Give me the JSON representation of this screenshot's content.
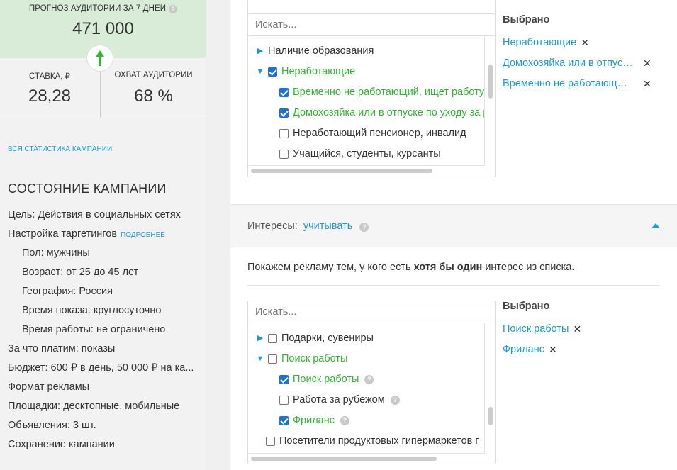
{
  "sidebar": {
    "forecast_label": "ПРОГНОЗ АУДИТОРИИ ЗА 7 ДНЕЙ",
    "forecast_value": "471 000",
    "rate_label": "СТАВКА, ₽",
    "rate_value": "28,28",
    "coverage_label": "ОХВАТ АУДИТОРИИ",
    "coverage_value": "68 %",
    "all_stats_link": "ВСЯ СТАТИСТИКА КАМПАНИИ",
    "state_title": "СОСТОЯНИЕ КАМПАНИИ",
    "summary": [
      "Цель: Действия в социальных сетях",
      "Настройка таргетингов",
      "Пол: мужчины",
      "Возраст: от 25 до 45 лет",
      "География: Россия",
      "Время показа: круглосуточно",
      "Время работы: не ограничено",
      "За что платим: показы",
      "Бюджет: 600 ₽ в день, 50 000 ₽ на ка...",
      "Формат рекламы",
      "Площадки: десктопные, мобильные",
      "Объявления: 3 шт.",
      "Сохранение кампании"
    ],
    "targeting_more": "ПОДРОБНЕЕ"
  },
  "employment": {
    "search_placeholder": "Искать...",
    "tree": [
      {
        "label": "Наличие образования",
        "expander": "collapsed",
        "checkbox": false,
        "checked": false,
        "green": false
      },
      {
        "label": "Неработающие",
        "expander": "expanded",
        "checkbox": true,
        "checked": true,
        "green": true
      },
      {
        "label": "Временно не работающий, ищет работу",
        "expander": "none",
        "checkbox": true,
        "checked": true,
        "green": true
      },
      {
        "label": "Домохозяйка или в отпуске по уходу за ребенком",
        "expander": "none",
        "checkbox": true,
        "checked": true,
        "green": true
      },
      {
        "label": "Неработающий пенсионер, инвалид",
        "expander": "none",
        "checkbox": true,
        "checked": false,
        "green": false
      },
      {
        "label": "Учащийся, студенты, курсанты",
        "expander": "none",
        "checkbox": true,
        "checked": false,
        "green": false
      }
    ],
    "selected_title": "Выбрано",
    "selected": [
      "Неработающие",
      "Домохозяйка или в отпуске по уходу за ребенком",
      "Временно не работающий, ищет работу"
    ]
  },
  "interests": {
    "label": "Интересы:",
    "mode_link": "учитывать",
    "description_before": "Покажем рекламу тем, у кого есть",
    "description_bold": "хотя бы один",
    "description_after": "интерес из списка.",
    "search_placeholder": "Искать...",
    "tree": [
      {
        "label": "Подарки, сувениры",
        "expander": "collapsed",
        "checked": false,
        "green": false,
        "help": false
      },
      {
        "label": "Поиск работы",
        "expander": "expanded",
        "checked": false,
        "green": true,
        "help": false
      },
      {
        "label": "Поиск работы",
        "expander": "none",
        "checked": true,
        "green": true,
        "help": true
      },
      {
        "label": "Работа за рубежом",
        "expander": "none",
        "checked": false,
        "green": false,
        "help": true
      },
      {
        "label": "Фриланс",
        "expander": "none",
        "checked": true,
        "green": true,
        "help": true
      },
      {
        "label": "Посетители продуктовых гипермаркетов г",
        "expander": "none",
        "checked": false,
        "green": false,
        "help": false
      }
    ],
    "selected_title": "Выбрано",
    "selected": [
      "Поиск работы",
      "Фриланс"
    ]
  },
  "colors": {
    "accent": "#1a9bd7",
    "green": "#2eb82e",
    "forecast_bg": "#d8ecd8"
  }
}
